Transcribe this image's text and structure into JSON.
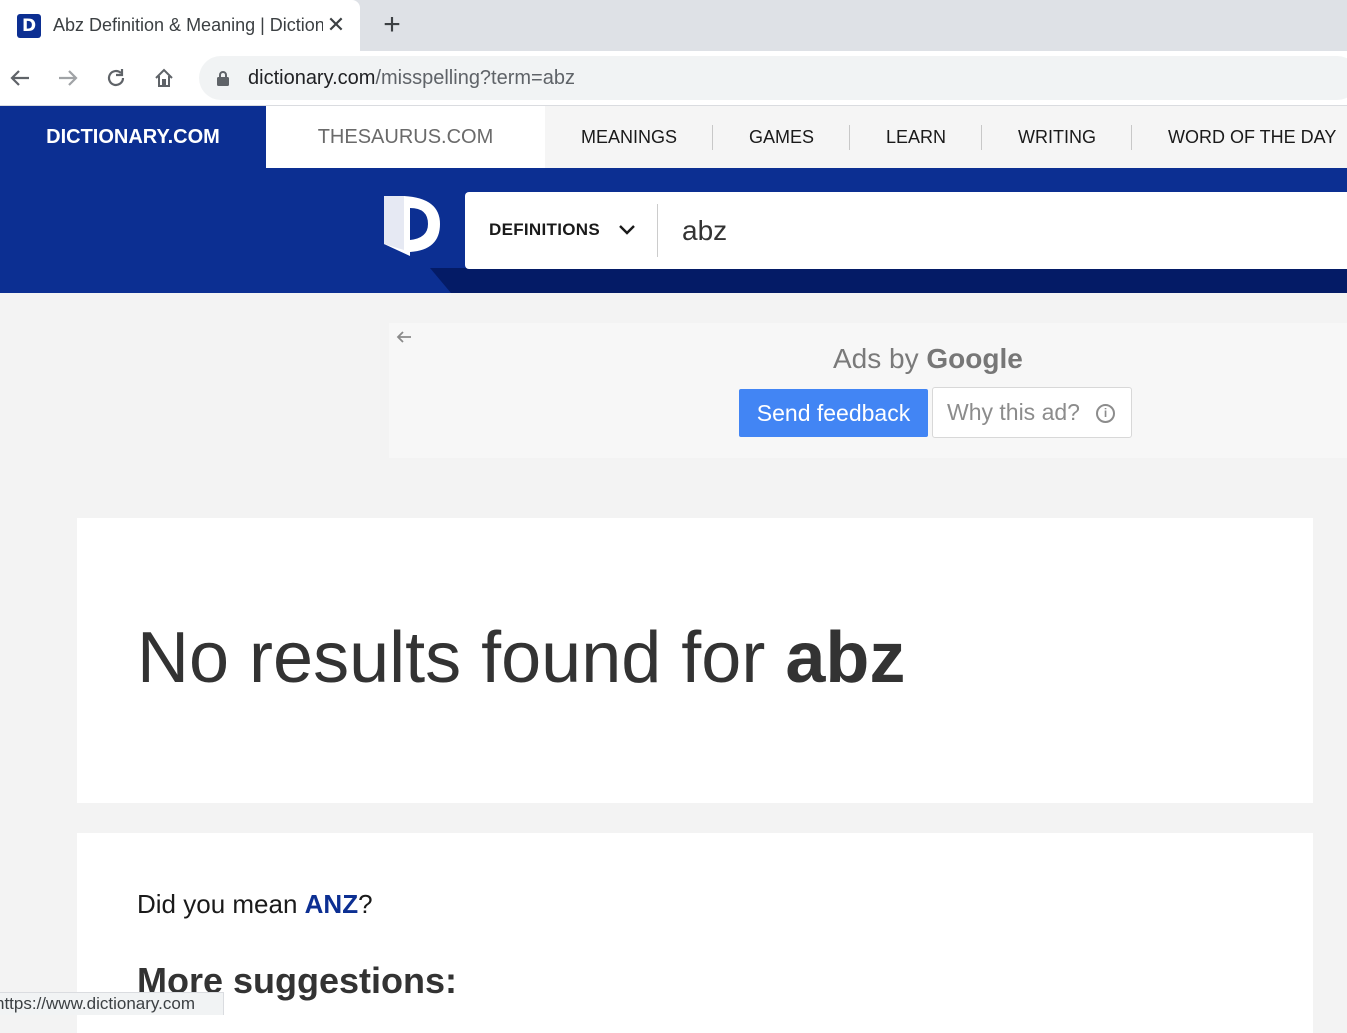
{
  "browser": {
    "tab_title": "Abz Definition & Meaning | Dictionary.com",
    "tab_favicon_letter": "D",
    "close_glyph": "✕",
    "new_tab_glyph": "+",
    "url_domain": "dictionary.com",
    "url_path": "/misspelling?term=abz",
    "status_url": "https://www.dictionary.com"
  },
  "site_nav": {
    "dictionary": "DICTIONARY.COM",
    "thesaurus": "THESAURUS.COM",
    "links": [
      "MEANINGS",
      "GAMES",
      "LEARN",
      "WRITING",
      "WORD OF THE DAY"
    ]
  },
  "search": {
    "mode_label": "DEFINITIONS",
    "query": "abz"
  },
  "ad": {
    "ads_by": "Ads by",
    "google": "Google",
    "send_feedback": "Send feedback",
    "why_this_ad": "Why this ad?",
    "info_glyph": "i"
  },
  "results": {
    "no_results_prefix": "No results found for ",
    "term": "abz",
    "did_you_mean_prefix": "Did you mean ",
    "suggestion": "ANZ",
    "did_you_mean_suffix": "?",
    "more_suggestions": "More suggestions:"
  },
  "colors": {
    "brand_blue": "#0c2f92",
    "feedback_blue": "#4285f4"
  }
}
